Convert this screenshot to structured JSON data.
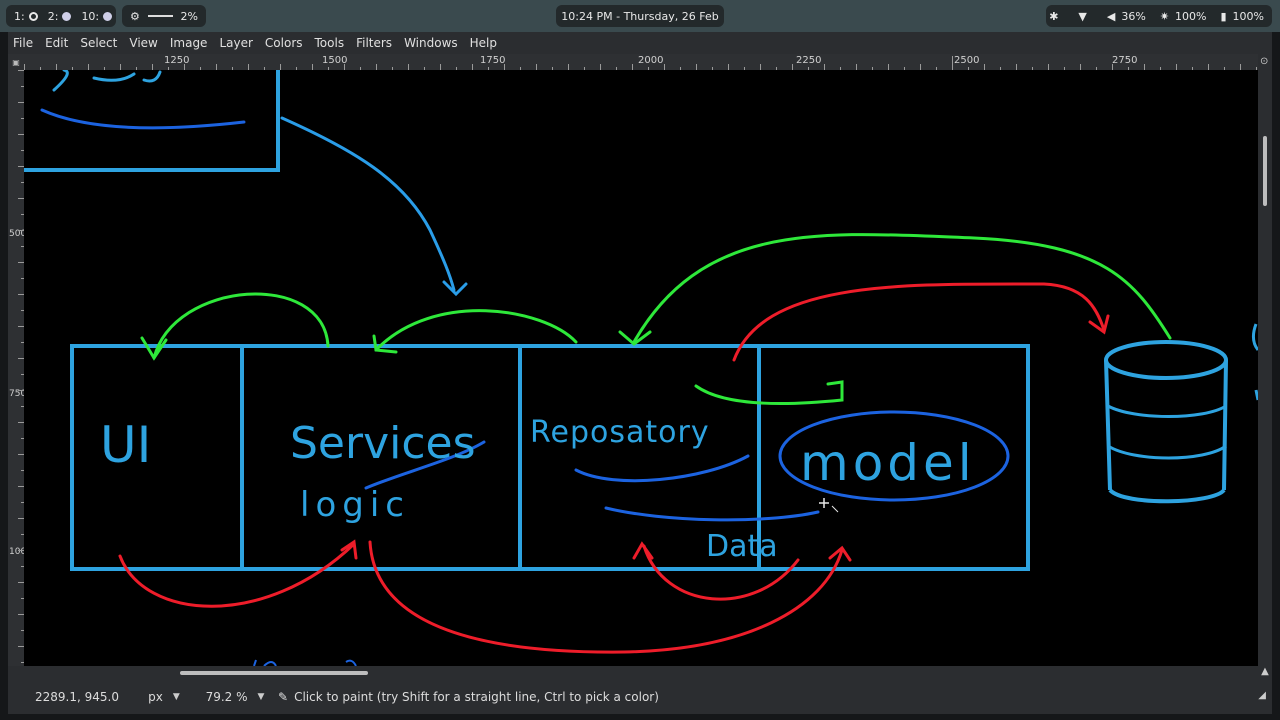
{
  "topbar": {
    "workspaces": [
      {
        "label": "1:",
        "state": "current"
      },
      {
        "label": "2:",
        "state": "occupied"
      },
      {
        "label": "10:",
        "state": "occupied"
      }
    ],
    "memory_percent": "2%",
    "clock": "10:24 PM  -  Thursday, 26 Feb",
    "volume": "36%",
    "brightness": "100%",
    "battery": "100%"
  },
  "menubar": {
    "items": [
      "File",
      "Edit",
      "Select",
      "View",
      "Image",
      "Layer",
      "Colors",
      "Tools",
      "Filters",
      "Windows",
      "Help"
    ]
  },
  "ruler": {
    "h_labels": [
      "1250",
      "1500",
      "1750",
      "2000",
      "2250",
      "2500",
      "2750"
    ],
    "v_labels": [
      "500",
      "750",
      "1000"
    ]
  },
  "canvas": {
    "texts": {
      "ui": "UI",
      "services": "Services",
      "logic": "logic",
      "repository": "Reposatory",
      "model": "model",
      "data": "Data"
    },
    "colors": {
      "background": "#000000",
      "box_blue": "#2ea3e0",
      "arrow_blue": "#2a9de8",
      "green": "#2ee83a",
      "red": "#ee1d2a",
      "underline_blue": "#1c63e0"
    }
  },
  "statusbar": {
    "pointer_coords": "2289.1, 945.0",
    "unit": "px",
    "zoom": "79.2 %",
    "hint": "Click to paint (try Shift for a straight line, Ctrl to pick a color)"
  }
}
